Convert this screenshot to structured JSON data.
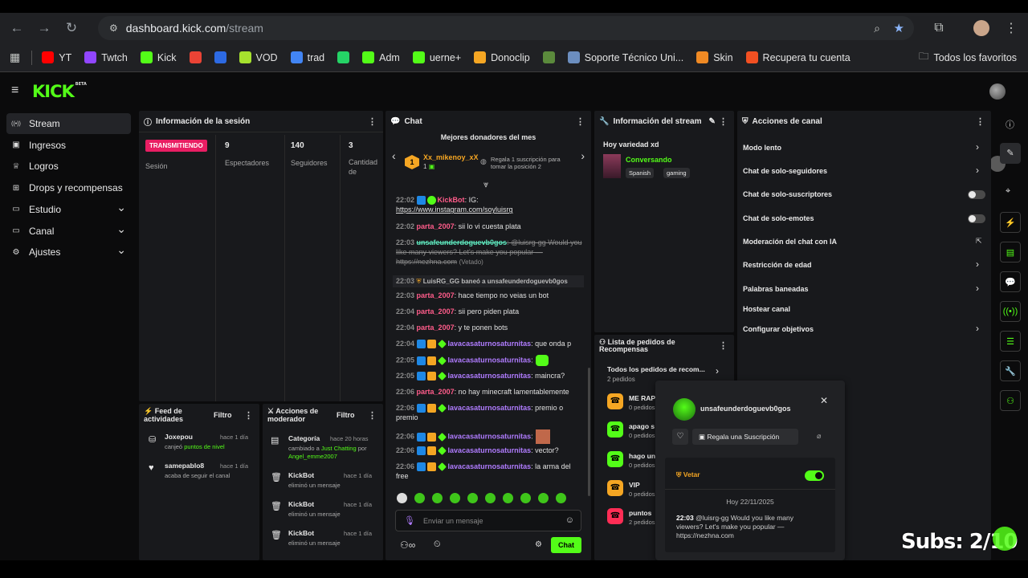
{
  "browser": {
    "url_host": "dashboard.kick.com",
    "url_path": "/stream",
    "bookmarks": [
      {
        "label": "YT",
        "icon": "youtube-icon",
        "color": "#ff0000"
      },
      {
        "label": "Twtch",
        "icon": "twitch-icon",
        "color": "#9146ff"
      },
      {
        "label": "Kick",
        "icon": "kick-icon",
        "color": "#53fc18"
      },
      {
        "label": "",
        "icon": "gmail-icon",
        "color": "#ea4335"
      },
      {
        "label": "",
        "icon": "grid-app-icon",
        "color": "#2d6ae3"
      },
      {
        "label": "VOD",
        "icon": "vod-icon",
        "color": "#a6e22e"
      },
      {
        "label": "trad",
        "icon": "google-icon",
        "color": "#4285f4"
      },
      {
        "label": "",
        "icon": "whatsapp-icon",
        "color": "#25d366"
      },
      {
        "label": "Adm",
        "icon": "kick-icon",
        "color": "#53fc18"
      },
      {
        "label": "uerne+",
        "icon": "kick-icon",
        "color": "#53fc18"
      },
      {
        "label": "Donoclip",
        "icon": "donoclip-icon",
        "color": "#f5a623"
      },
      {
        "label": "",
        "icon": "shield-app-icon",
        "color": "#5b8a3c"
      },
      {
        "label": "Soporte Técnico Uni...",
        "icon": "globe-icon",
        "color": "#6c8ebf"
      },
      {
        "label": "Skin",
        "icon": "skin-icon",
        "color": "#f08a24"
      },
      {
        "label": "Recupera tu cuenta",
        "icon": "microsoft-icon",
        "color": "#f25022"
      }
    ],
    "all_favorites": "Todos los favoritos"
  },
  "sidebar": {
    "items": [
      {
        "label": "Stream",
        "icon": "broadcast-icon",
        "active": true
      },
      {
        "label": "Ingresos",
        "icon": "money-icon"
      },
      {
        "label": "Logros",
        "icon": "trophy-icon"
      },
      {
        "label": "Drops y recompensas",
        "icon": "gift-icon"
      },
      {
        "label": "Estudio",
        "icon": "studio-icon",
        "expandable": true
      },
      {
        "label": "Canal",
        "icon": "channel-icon",
        "expandable": true
      },
      {
        "label": "Ajustes",
        "icon": "gear-icon",
        "expandable": true
      }
    ]
  },
  "session": {
    "title": "Información de la sesión",
    "live_badge": "TRANSMITIENDO",
    "session_label": "Sesión",
    "stats": [
      {
        "value": "9",
        "label": "Espectadores"
      },
      {
        "value": "140",
        "label": "Seguidores"
      },
      {
        "value": "3",
        "label": "Cantidad de suscripciones"
      }
    ]
  },
  "activity": {
    "title": "Feed de actividades",
    "filter": "Filtro",
    "items": [
      {
        "user": "Joxepou",
        "time": "hace 1 día",
        "text": "canjeó",
        "highlight": "puntos de nivel"
      },
      {
        "user": "samepablo8",
        "time": "hace 1 día",
        "text": "acaba de seguir el canal",
        "highlight": ""
      }
    ]
  },
  "modactions": {
    "title": "Acciones de moderador",
    "filter": "Filtro",
    "items": [
      {
        "user": "Categoría",
        "time": "hace 20 horas",
        "line1": "cambiado a",
        "highlight": "Just Chatting",
        "line2": "por",
        "by": "Angel_emme2007"
      },
      {
        "user": "KickBot",
        "time": "hace 1 día",
        "line1": "eliminó un mensaje"
      },
      {
        "user": "KickBot",
        "time": "hace 1 día",
        "line1": "eliminó un mensaje"
      },
      {
        "user": "KickBot",
        "time": "hace 1 día",
        "line1": "eliminó un mensaje"
      }
    ]
  },
  "chat": {
    "title": "Chat",
    "donors_title": "Mejores donadores del mes",
    "donor_name": "Xx_mikenoy_xX",
    "donor_count": "1",
    "donor_rank": "1",
    "gift_hint": "Regala 1 suscripción para tomar la posición 2",
    "messages": [
      {
        "time": "22:02",
        "user": "KickBot",
        "text": ": IG:",
        "link": "https://www.instagram.com/soyluisrg",
        "color": "pink"
      },
      {
        "time": "22:02",
        "user": "parta_2007",
        "text": ": sii lo vi cuesta plata",
        "color": "pink"
      },
      {
        "time": "22:03",
        "user": "unsafeunderdoguevb0gos",
        "text": ": @luisrg-gg Would you like many viewers? Let's make you popular — https://nezhna.com",
        "tag": "(Vetado)",
        "color": "teal"
      },
      {
        "time": "22:03",
        "text": "LuisRG_GG baneó a unsafeunderdoguevb0gos",
        "system": true
      },
      {
        "time": "22:03",
        "user": "parta_2007",
        "text": ": hace tiempo no veias un bot",
        "color": "pink"
      },
      {
        "time": "22:04",
        "user": "parta_2007",
        "text": ": sii pero piden plata",
        "color": "pink"
      },
      {
        "time": "22:04",
        "user": "parta_2007",
        "text": ": y te ponen bots",
        "color": "pink"
      },
      {
        "time": "22:04",
        "user": "lavacasaturnosaturnitas",
        "text": ": que onda p",
        "color": "purple"
      },
      {
        "time": "22:05",
        "user": "lavacasaturnosaturnitas",
        "text": ":",
        "color": "purple"
      },
      {
        "time": "22:05",
        "user": "lavacasaturnosaturnitas",
        "text": ": maincra?",
        "color": "purple"
      },
      {
        "time": "22:06",
        "user": "parta_2007",
        "text": ": no hay minecraft lamentablemente",
        "color": "pink"
      },
      {
        "time": "22:06",
        "user": "lavacasaturnosaturnitas",
        "text": ": premio o premio",
        "color": "purple"
      },
      {
        "time": "22:06",
        "user": "lavacasaturnosaturnitas",
        "text": ":",
        "color": "purple"
      },
      {
        "time": "22:06",
        "user": "lavacasaturnosaturnitas",
        "text": ": vector?",
        "color": "purple"
      },
      {
        "time": "22:06",
        "user": "lavacasaturnosaturnitas",
        "text": ": la arma del free",
        "color": "purple"
      }
    ],
    "input_placeholder": "Enviar un mensaje",
    "send_label": "Chat"
  },
  "streaminfo": {
    "title": "Información del stream",
    "stream_title": "Hoy variedad xd",
    "category": "Conversando",
    "tags": [
      "Spanish",
      "gaming"
    ]
  },
  "rewards": {
    "title": "Lista de pedidos de Recompensas",
    "all": "Todos los pedidos de recom...",
    "all_count": "2 pedidos",
    "items": [
      {
        "name": "ME RAP",
        "count": "0 pedidos",
        "color": "#f5a623"
      },
      {
        "name": "apago s",
        "count": "0 pedidos",
        "color": "#53fc18"
      },
      {
        "name": "hago un",
        "count": "0 pedidos",
        "color": "#53fc18"
      },
      {
        "name": "VIP",
        "count": "0 pedidos",
        "color": "#f5a623"
      },
      {
        "name": "puntos",
        "count": "2 pedidos",
        "color": "#ff2d55"
      }
    ]
  },
  "channelactions": {
    "title": "Acciones de canal",
    "items": [
      {
        "label": "Modo lento",
        "control": "arrow"
      },
      {
        "label": "Chat de solo-seguidores",
        "control": "arrow"
      },
      {
        "label": "Chat de solo-suscriptores",
        "control": "toggle"
      },
      {
        "label": "Chat de solo-emotes",
        "control": "toggle"
      },
      {
        "label": "Moderación del chat con IA",
        "control": "external"
      },
      {
        "label": "Restricción de edad",
        "control": "arrow"
      },
      {
        "label": "Palabras baneadas",
        "control": "arrow"
      },
      {
        "label": "Hostear canal",
        "control": "none"
      },
      {
        "label": "Configurar objetivos",
        "control": "arrow"
      }
    ]
  },
  "usercard": {
    "username": "unsafeunderdoguevb0gos",
    "gift_button": "Regala una Suscripción",
    "ban_label": "Vetar",
    "date": "Hoy 22/11/2025",
    "msg_time": "22:03",
    "msg_text": "@luisrg-gg Would you like many viewers? Let's make you popular — https://nezhna.com"
  },
  "overlay": {
    "subs_text": "Subs: 2/10"
  }
}
